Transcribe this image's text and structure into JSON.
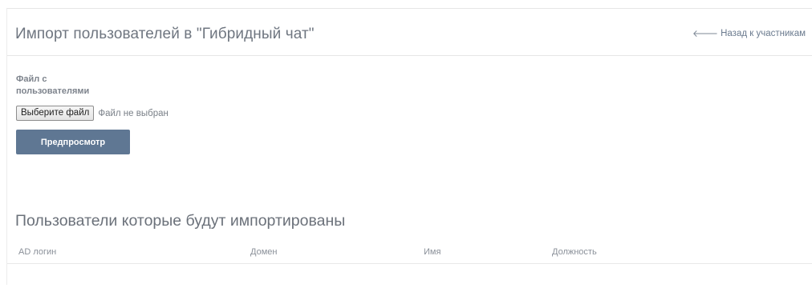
{
  "header": {
    "title": "Импорт пользователей в \"Гибридный чат\"",
    "back_link": {
      "label": "Назад к участникам",
      "icon": "arrow-left-icon"
    }
  },
  "upload": {
    "label": "Файл с пользователями",
    "choose_button": "Выберите файл",
    "status": "Файл не выбран"
  },
  "actions": {
    "preview_label": "Предпросмотр"
  },
  "users_table": {
    "title": "Пользователи которые будут импортированы",
    "columns": [
      "AD логин",
      "Домен",
      "Имя",
      "Должность"
    ],
    "rows": []
  },
  "colors": {
    "primary_button": "#5f7793",
    "title_text": "#6f7680",
    "link_text": "#6a7a8e"
  }
}
